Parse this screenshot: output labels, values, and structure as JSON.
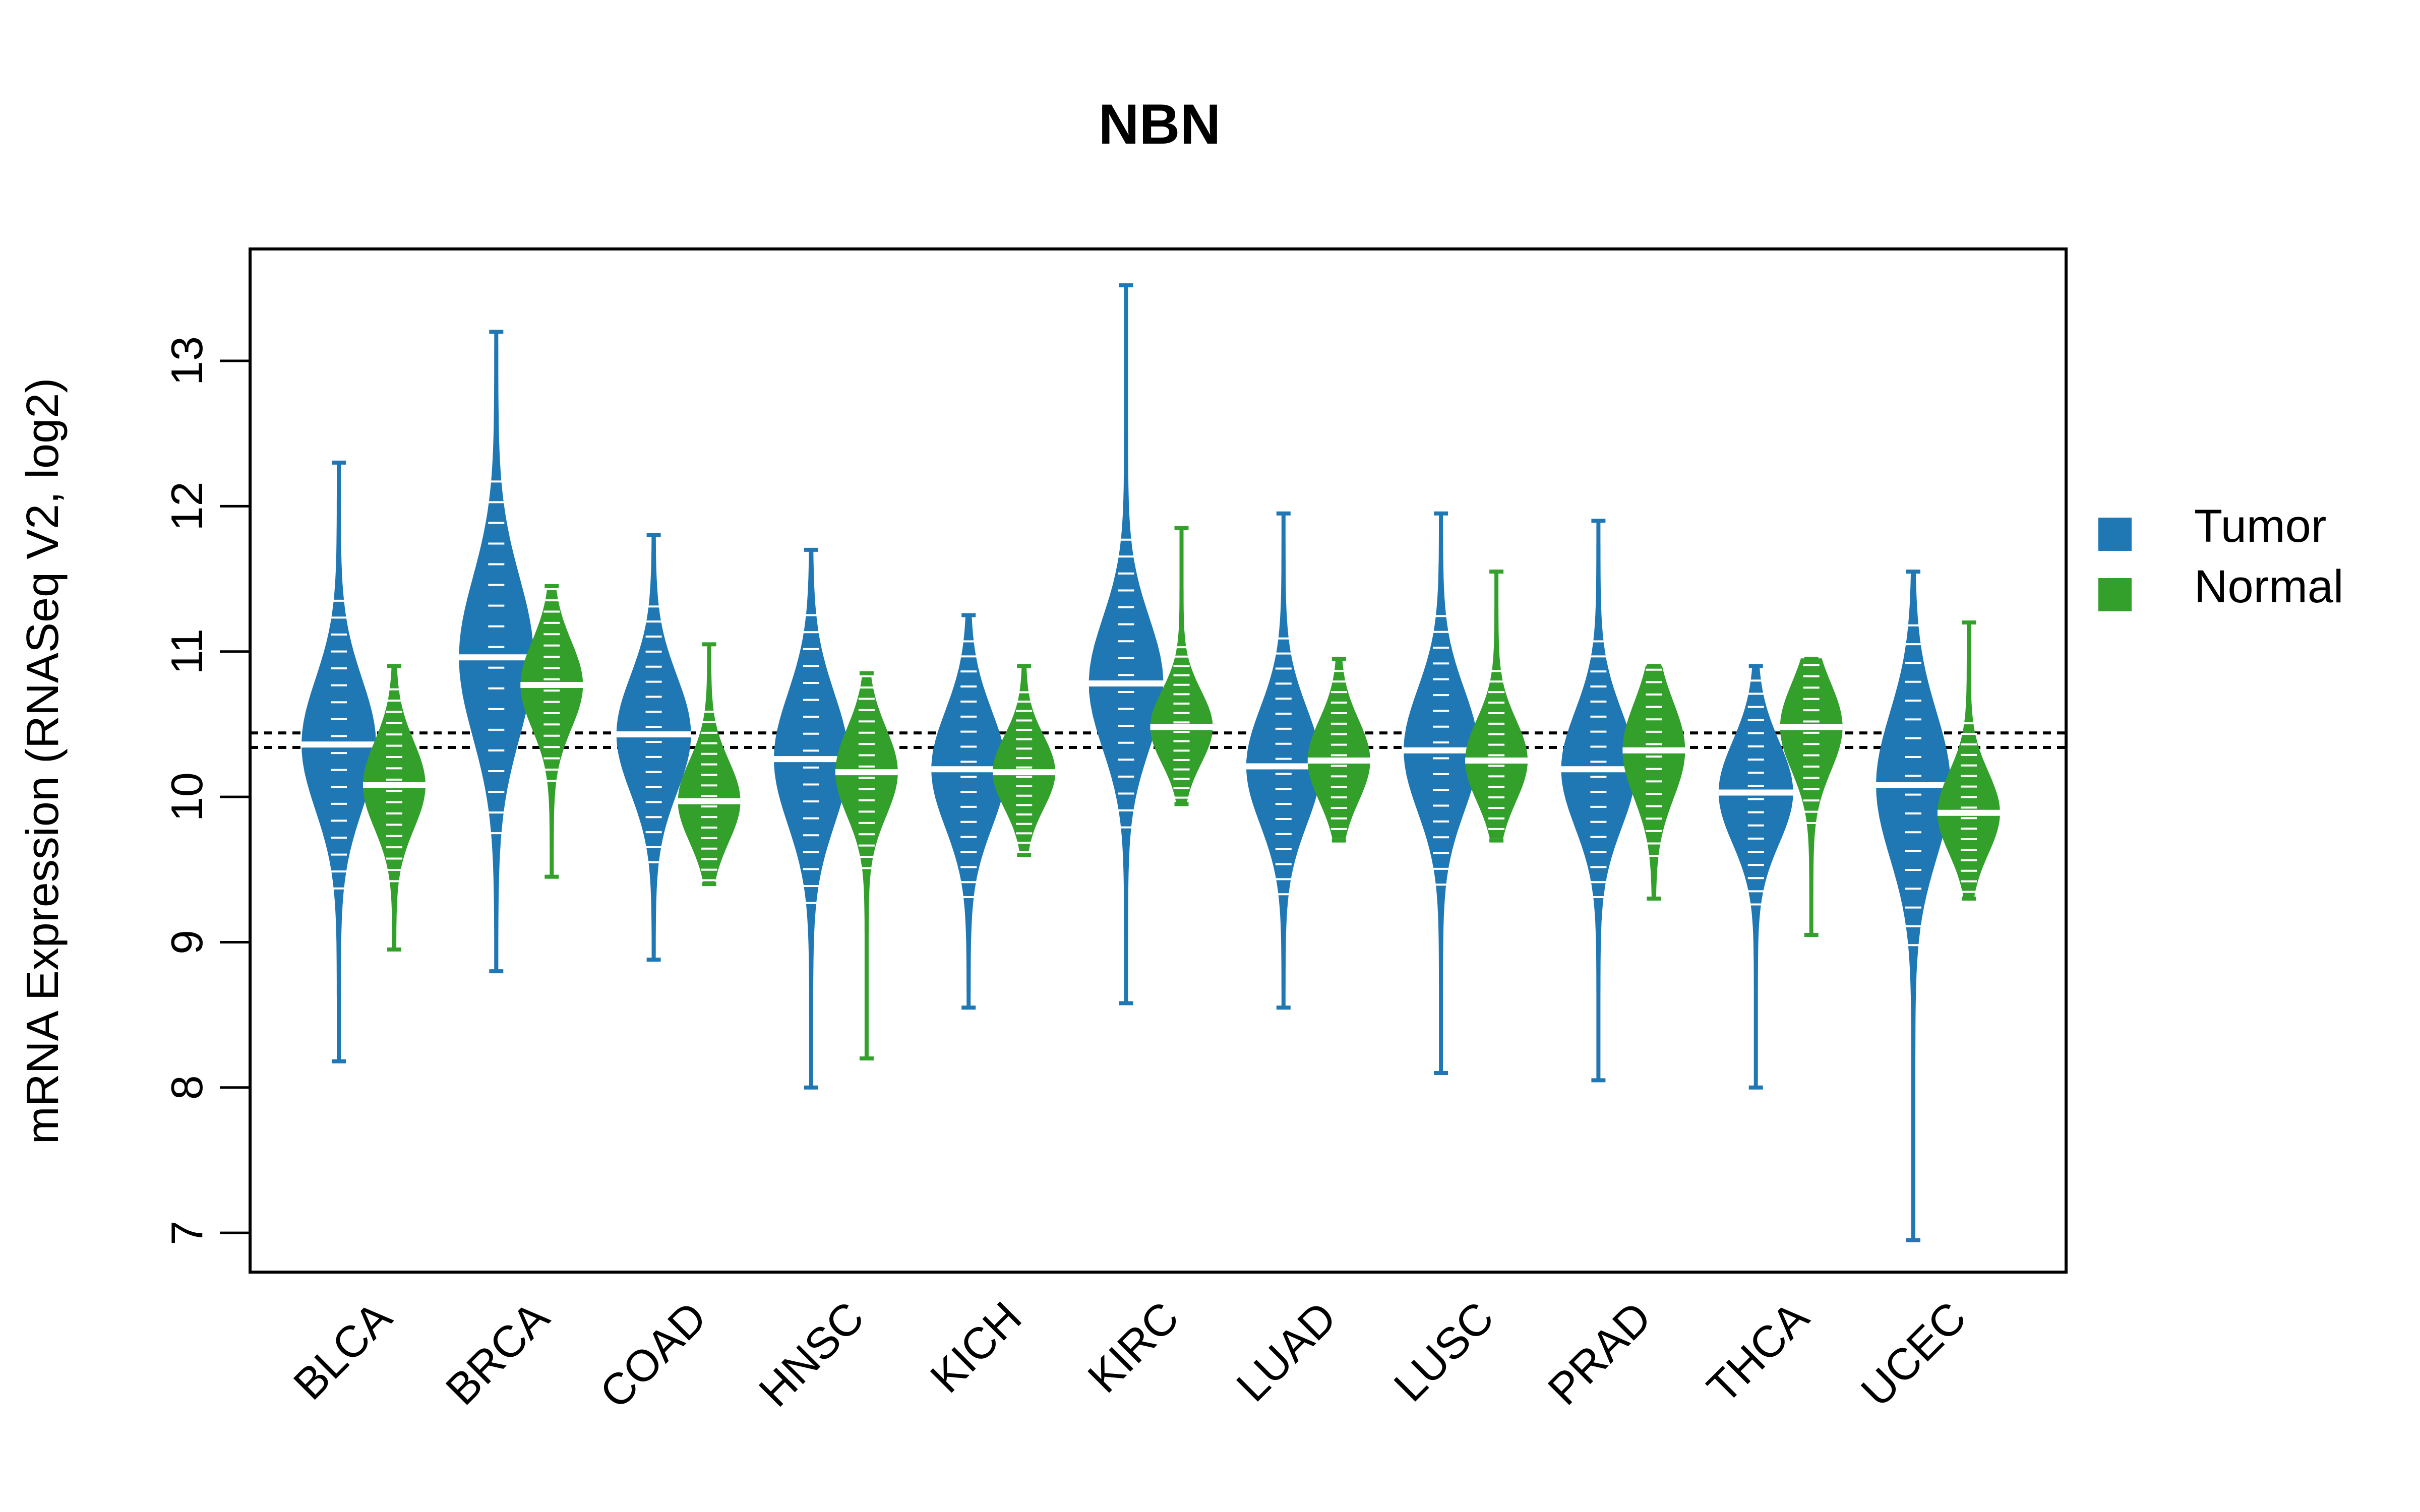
{
  "chart_data": {
    "type": "violin",
    "title": "NBN",
    "xlabel": "",
    "ylabel": "mRNA Expression (RNASeq V2, log2)",
    "ylim": [
      6.73,
      13.77
    ],
    "yticks": [
      7,
      8,
      9,
      10,
      11,
      12,
      13
    ],
    "grid": false,
    "legend": {
      "placement": "right",
      "entries": [
        {
          "name": "Tumor",
          "color": "#1F78B4"
        },
        {
          "name": "Normal",
          "color": "#33A02C"
        }
      ]
    },
    "reference_lines": [
      10.44,
      10.34
    ],
    "categories": [
      "BLCA",
      "BRCA",
      "COAD",
      "HNSC",
      "KICH",
      "KIRC",
      "LUAD",
      "LUSC",
      "PRAD",
      "THCA",
      "UCEC"
    ],
    "series": [
      {
        "name": "Tumor",
        "color": "#1F78B4",
        "median": [
          10.36,
          10.96,
          10.43,
          10.26,
          10.19,
          10.78,
          10.21,
          10.32,
          10.19,
          10.03,
          10.08
        ],
        "min": [
          8.18,
          8.8,
          8.88,
          8.0,
          8.55,
          8.58,
          8.55,
          8.1,
          8.05,
          8.0,
          6.95
        ],
        "max": [
          12.3,
          13.2,
          11.8,
          11.7,
          11.25,
          13.52,
          11.95,
          11.95,
          11.9,
          10.9,
          11.55
        ],
        "spread": [
          0.45,
          0.55,
          0.4,
          0.45,
          0.4,
          0.45,
          0.4,
          0.42,
          0.4,
          0.35,
          0.5
        ]
      },
      {
        "name": "Normal",
        "color": "#33A02C",
        "median": [
          10.08,
          10.77,
          9.97,
          10.17,
          10.17,
          10.48,
          10.25,
          10.25,
          10.32,
          10.48,
          9.89
        ],
        "min": [
          8.95,
          9.45,
          9.4,
          8.2,
          9.6,
          9.95,
          9.7,
          9.7,
          9.3,
          9.05,
          9.3
        ],
        "max": [
          10.9,
          11.45,
          11.05,
          10.85,
          10.9,
          11.85,
          10.95,
          11.55,
          10.9,
          10.95,
          11.2
        ],
        "spread": [
          0.3,
          0.3,
          0.28,
          0.3,
          0.25,
          0.25,
          0.28,
          0.28,
          0.33,
          0.3,
          0.28
        ]
      }
    ]
  }
}
